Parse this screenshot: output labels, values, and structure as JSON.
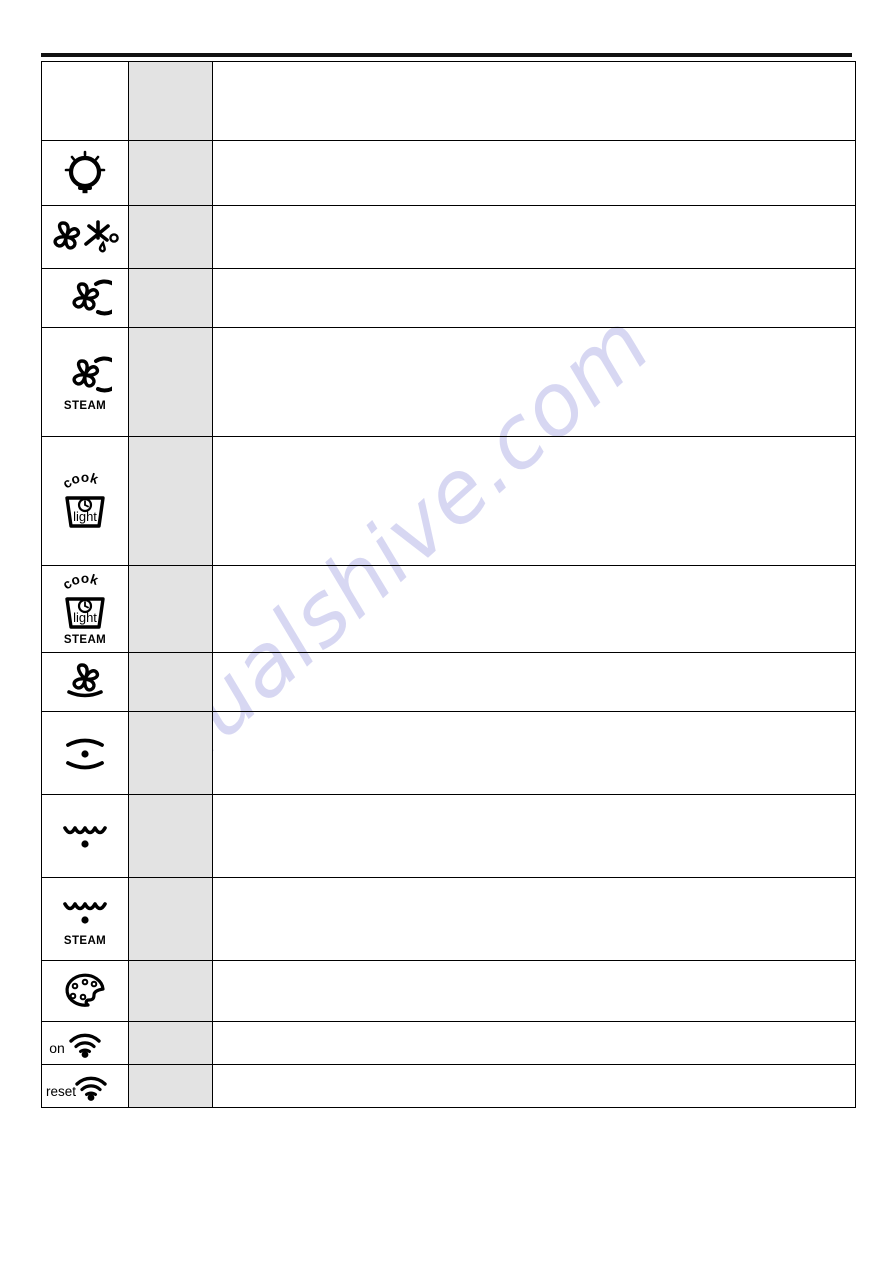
{
  "page": {
    "watermark": "manualshive.com",
    "watermark_color": "#c9c9ee",
    "background_color": "#ffffff",
    "rule_color": "#111111"
  },
  "table": {
    "shaded_column_color": "#e3e3e3",
    "border_color": "#000000",
    "columns": [
      {
        "key": "icon",
        "header": ""
      },
      {
        "key": "shaded",
        "header": ""
      },
      {
        "key": "description",
        "header": ""
      }
    ],
    "rows": [
      {
        "icon_name": "blank-icon",
        "icon_label": "",
        "sub_label": "",
        "shaded_value": "",
        "description": ""
      },
      {
        "icon_name": "oven-lamp-icon",
        "icon_label": "",
        "sub_label": "",
        "shaded_value": "",
        "description": ""
      },
      {
        "icon_name": "fan-defrost-icon",
        "icon_label": "",
        "sub_label": "",
        "shaded_value": "",
        "description": ""
      },
      {
        "icon_name": "fan-in-circle-icon",
        "icon_label": "",
        "sub_label": "",
        "shaded_value": "",
        "description": ""
      },
      {
        "icon_name": "fan-in-circle-steam-icon",
        "icon_label": "",
        "sub_label": "STEAM",
        "shaded_value": "",
        "description": ""
      },
      {
        "icon_name": "cook-light-icon",
        "icon_label": "",
        "sub_label": "",
        "shaded_value": "",
        "description": ""
      },
      {
        "icon_name": "cook-light-steam-icon",
        "icon_label": "",
        "sub_label": "STEAM",
        "shaded_value": "",
        "description": ""
      },
      {
        "icon_name": "fan-bottom-heat-icon",
        "icon_label": "",
        "sub_label": "",
        "shaded_value": "",
        "description": ""
      },
      {
        "icon_name": "top-bottom-heat-dot-icon",
        "icon_label": "",
        "sub_label": "",
        "shaded_value": "",
        "description": ""
      },
      {
        "icon_name": "wave-dot-icon",
        "icon_label": "",
        "sub_label": "",
        "shaded_value": "",
        "description": ""
      },
      {
        "icon_name": "wave-dot-steam-icon",
        "icon_label": "",
        "sub_label": "STEAM",
        "shaded_value": "",
        "description": ""
      },
      {
        "icon_name": "palette-icon",
        "icon_label": "",
        "sub_label": "",
        "shaded_value": "",
        "description": ""
      },
      {
        "icon_name": "wifi-on-icon",
        "icon_label": "on",
        "sub_label": "",
        "shaded_value": "",
        "description": ""
      },
      {
        "icon_name": "wifi-reset-icon",
        "icon_label": "reset",
        "sub_label": "",
        "shaded_value": "",
        "description": ""
      }
    ]
  },
  "icon_glyph_text": {
    "cook_top": "cook",
    "cook_inner": "light",
    "wifi_on": "on",
    "wifi_reset": "reset",
    "steam": "STEAM"
  }
}
